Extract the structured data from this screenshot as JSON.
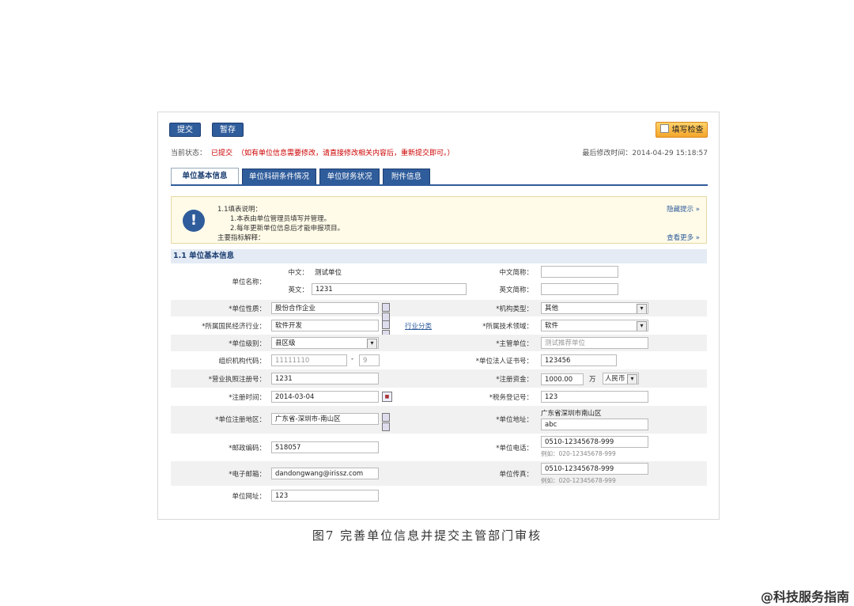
{
  "toolbar": {
    "submit_label": "提交",
    "save_label": "暂存",
    "fill_check_label": "填写检查"
  },
  "status": {
    "label": "当前状态：",
    "value": "已提交",
    "note": "（如有单位信息需要修改，请直接修改相关内容后，重新提交即可。）",
    "last_modified": "最后修改时间：2014-04-29 15:18:57"
  },
  "tabs": [
    "单位基本信息",
    "单位科研条件情况",
    "单位财务状况",
    "附件信息"
  ],
  "notice": {
    "line1": "1.1填表说明：",
    "line2": "1.本表由单位管理员填写并管理。",
    "line3": "2.每年更新单位信息后才能申报项目。",
    "line4": "主要指标解释：",
    "hide_tip": "隐藏提示 »",
    "see_more": "查看更多 »"
  },
  "section_title": "1.1  单位基本信息",
  "form": {
    "unit_name_label": "单位名称：",
    "cn_label": "中文：",
    "cn_value": "测试单位",
    "en_label": "英文：",
    "en_value": "1231",
    "cn_abbr_label": "中文简称：",
    "cn_abbr_value": "",
    "en_abbr_label": "英文简称：",
    "en_abbr_value": "",
    "nature_label": "*单位性质：",
    "nature_value": "股份合作企业",
    "org_type_label": "*机构类型：",
    "org_type_value": "其他",
    "industry_label": "*所属国民经济行业：",
    "industry_value": "软件开发",
    "industry_link": "行业分类",
    "tech_field_label": "*所属技术领域：",
    "tech_field_value": "软件",
    "level_label": "*单位级别：",
    "level_value": "县区级",
    "supervisor_label": "*主管单位：",
    "supervisor_value": "测试推荐单位",
    "org_code_label": "组织机构代码：",
    "org_code_value": "11111110",
    "org_code_dash": "-",
    "org_code_check": "9",
    "legal_cert_label": "*单位法人证书号：",
    "legal_cert_value": "123456",
    "license_label": "*营业执照注册号：",
    "license_value": "1231",
    "capital_label": "*注册资金：",
    "capital_value": "1000.00",
    "capital_unit": "万",
    "currency_value": "人民币",
    "reg_date_label": "*注册时间：",
    "reg_date_value": "2014-03-04",
    "tax_label": "*税务登记号：",
    "tax_value": "123",
    "reg_area_label": "*单位注册地区：",
    "reg_area_value": "广东省-深圳市-南山区",
    "address_label": "*单位地址：",
    "address_prefix": "广东省深圳市南山区",
    "address_value": "abc",
    "postcode_label": "*邮政编码：",
    "postcode_value": "518057",
    "phone_label": "*单位电话：",
    "phone_value": "0510-12345678-999",
    "phone_hint": "例如：020-12345678-999",
    "email_label": "*电子邮箱：",
    "email_value": "dandongwang@irissz.com",
    "fax_label": "单位传真：",
    "fax_value": "0510-12345678-999",
    "fax_hint": "例如：020-12345678-999",
    "website_label": "单位网址：",
    "website_value": "123"
  },
  "caption": "图7  完善单位信息并提交主管部门审核",
  "watermark": "@科技服务指南"
}
